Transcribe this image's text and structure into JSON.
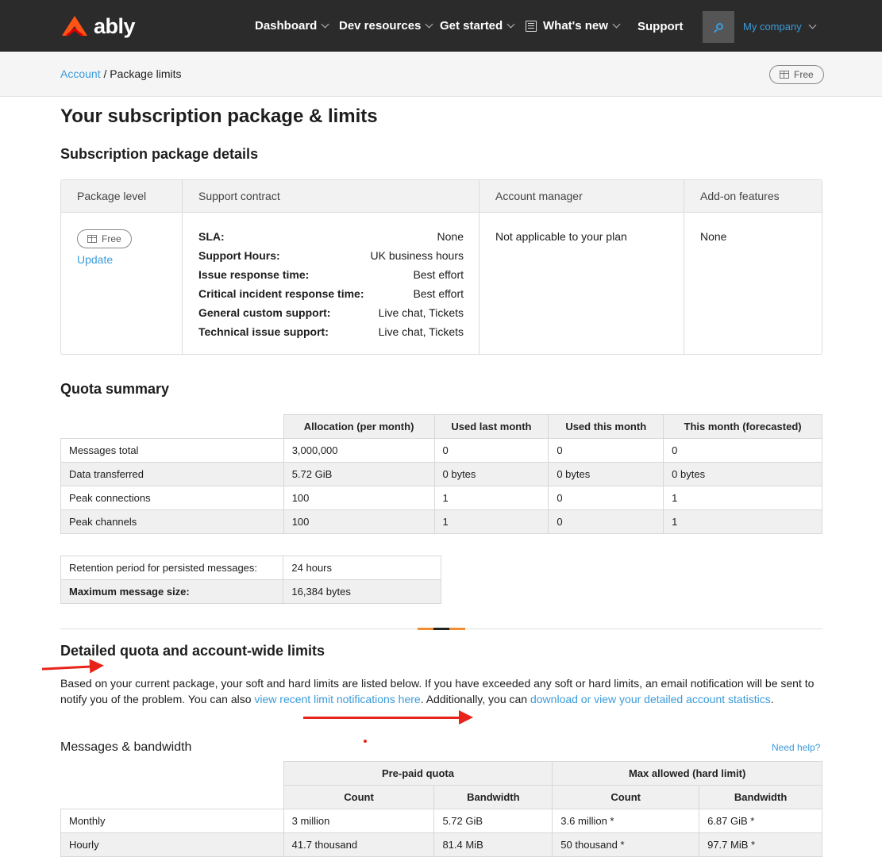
{
  "nav": {
    "logo_text": "ably",
    "items": [
      {
        "label": "Dashboard"
      },
      {
        "label": "Dev resources"
      },
      {
        "label": "Get started"
      },
      {
        "label": "What's new"
      },
      {
        "label": "Support"
      }
    ],
    "company": "My company"
  },
  "breadcrumb": {
    "parent": "Account",
    "separator": " / ",
    "current": "Package limits",
    "plan_badge": "Free"
  },
  "page_title": "Your subscription package & limits",
  "package": {
    "heading": "Subscription package details",
    "columns": [
      "Package level",
      "Support contract",
      "Account manager",
      "Add-on features"
    ],
    "level_badge": "Free",
    "update_label": "Update",
    "support": [
      {
        "k": "SLA:",
        "v": "None"
      },
      {
        "k": "Support Hours:",
        "v": "UK business hours"
      },
      {
        "k": "Issue response time:",
        "v": "Best effort"
      },
      {
        "k": "Critical incident response time:",
        "v": "Best effort"
      },
      {
        "k": "General custom support:",
        "v": "Live chat, Tickets"
      },
      {
        "k": "Technical issue support:",
        "v": "Live chat, Tickets"
      }
    ],
    "account_manager": "Not applicable to your plan",
    "addons": "None"
  },
  "quota": {
    "heading": "Quota summary",
    "columns": [
      "Allocation (per month)",
      "Used last month",
      "Used this month",
      "This month (forecasted)"
    ],
    "rows": [
      {
        "name": "Messages total",
        "vals": [
          "3,000,000",
          "0",
          "0",
          "0"
        ]
      },
      {
        "name": "Data transferred",
        "vals": [
          "5.72 GiB",
          "0 bytes",
          "0 bytes",
          "0 bytes"
        ]
      },
      {
        "name": "Peak connections",
        "vals": [
          "100",
          "1",
          "0",
          "1"
        ]
      },
      {
        "name": "Peak channels",
        "vals": [
          "100",
          "1",
          "0",
          "1"
        ]
      }
    ]
  },
  "retention": {
    "rows": [
      {
        "name": "Retention period for persisted messages:",
        "val": "24 hours"
      },
      {
        "name": "Maximum message size:",
        "val": "16,384 bytes"
      }
    ]
  },
  "limits": {
    "heading": "Detailed quota and account-wide limits",
    "para_1": "Based on your current package, your soft and hard limits are listed below. If you have exceeded any soft or hard limits, an email notification will be sent to notify you of the problem. You can also ",
    "link_1": "view recent limit notifications here",
    "para_2": ". Additionally, you can ",
    "link_2": "download or view your detailed account statistics",
    "para_3": "."
  },
  "bandwidth": {
    "heading": "Messages & bandwidth",
    "help": "Need help?",
    "group_1": "Pre-paid quota",
    "group_2": "Max allowed (hard limit)",
    "sub_count": "Count",
    "sub_bandwidth": "Bandwidth",
    "rows": [
      {
        "name": "Monthly",
        "vals": [
          "3 million",
          "5.72 GiB",
          "3.6 million *",
          "6.87 GiB *"
        ]
      },
      {
        "name": "Hourly",
        "vals": [
          "41.7 thousand",
          "81.4 MiB",
          "50 thousand *",
          "97.7 MiB *"
        ]
      }
    ]
  },
  "colors": {
    "accent": "#3b9bd9",
    "annotation": "#e8231a",
    "nav_bg": "#2b2b2b"
  }
}
